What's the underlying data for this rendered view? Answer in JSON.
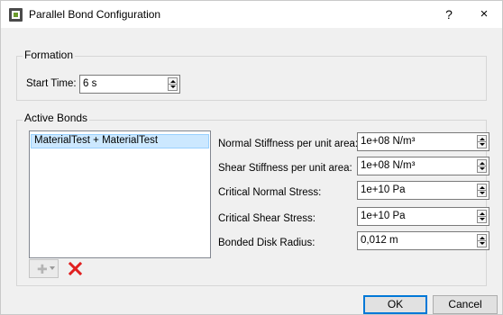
{
  "window": {
    "title": "Parallel Bond Configuration",
    "help_label": "?",
    "close_label": "×"
  },
  "formation": {
    "group_label": "Formation",
    "start_time_label": "Start Time:",
    "start_time_value": "6 s"
  },
  "active_bonds": {
    "group_label": "Active Bonds",
    "list_items": [
      "MaterialTest + MaterialTest"
    ],
    "fields": [
      {
        "label": "Normal Stiffness per unit area:",
        "value": "1e+08 N/m³"
      },
      {
        "label": "Shear Stiffness per unit area:",
        "value": "1e+08 N/m³"
      },
      {
        "label": "Critical Normal Stress:",
        "value": "1e+10 Pa"
      },
      {
        "label": "Critical Shear Stress:",
        "value": "1e+10 Pa"
      },
      {
        "label": "Bonded Disk Radius:",
        "value": "0,012 m"
      }
    ],
    "add_icon": "plus-icon",
    "delete_icon": "red-x-icon"
  },
  "buttons": {
    "ok_label": "OK",
    "cancel_label": "Cancel"
  },
  "colors": {
    "selection": "#cce8ff",
    "default_button_border": "#0078d7",
    "delete_icon": "#e02020"
  }
}
